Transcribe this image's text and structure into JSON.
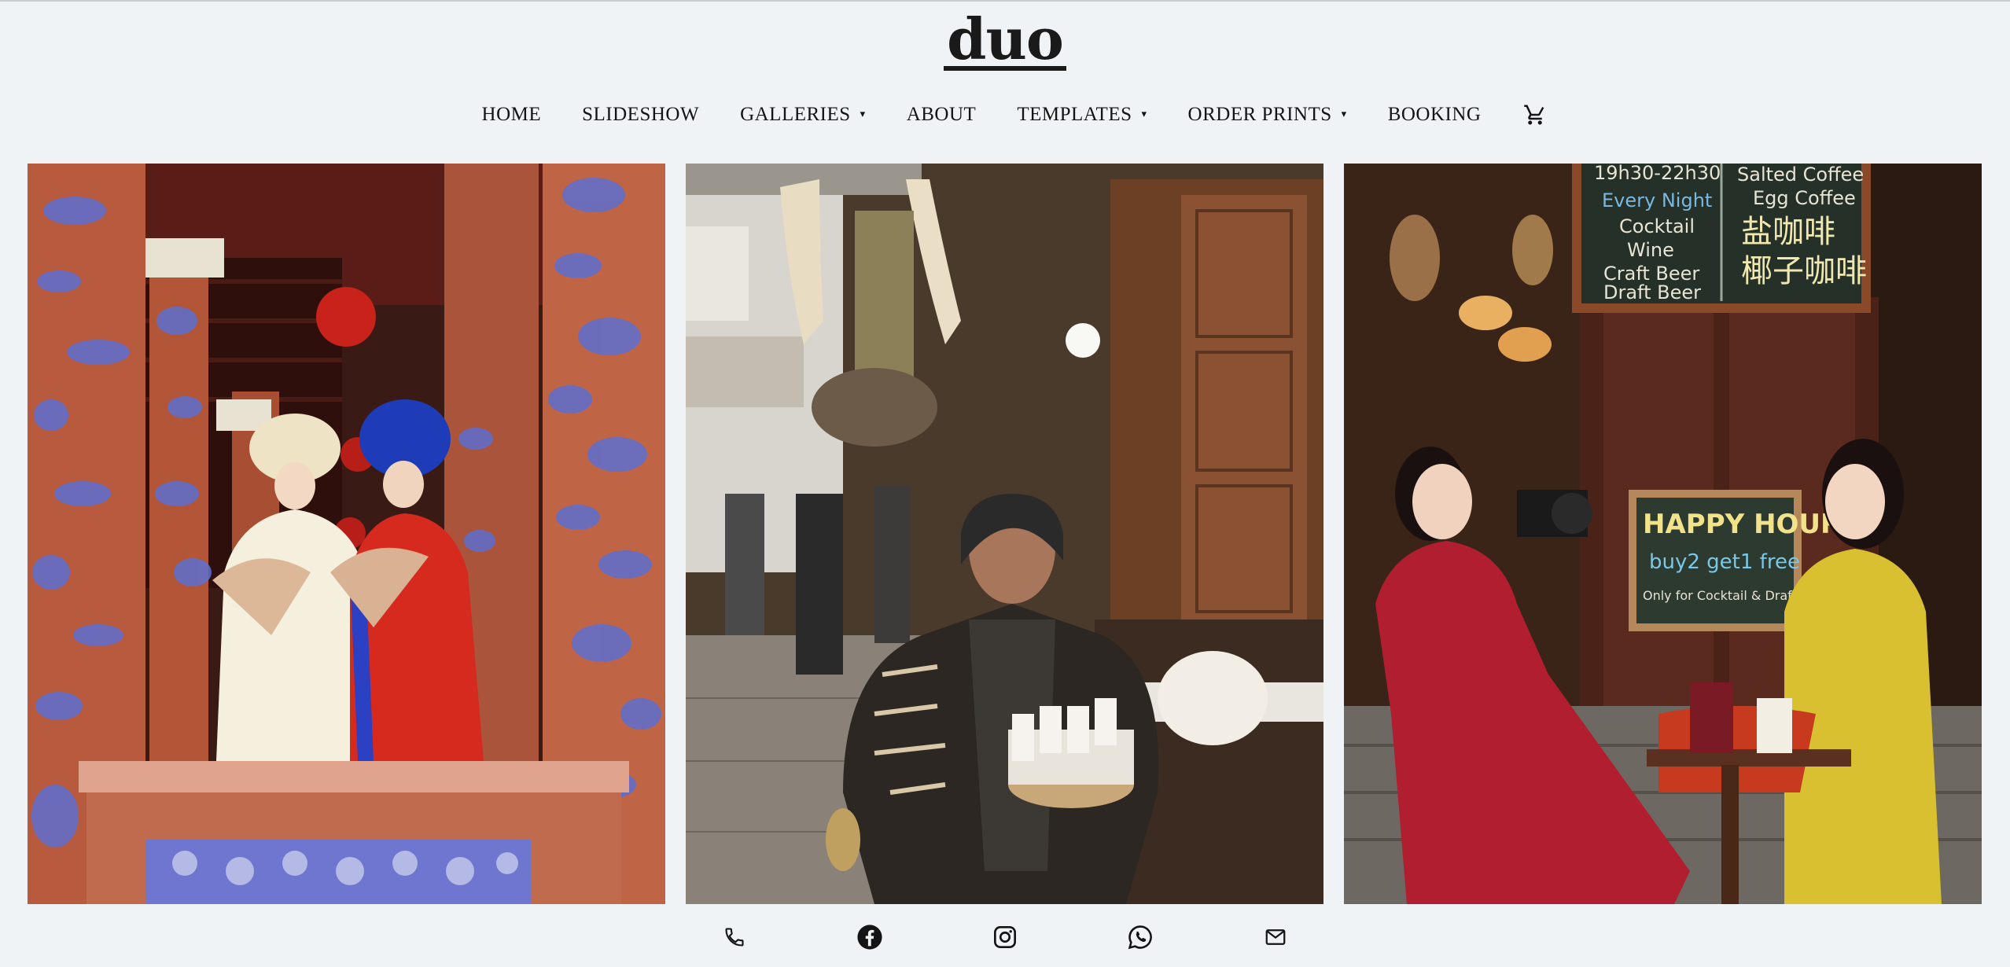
{
  "site": {
    "logo": "duo"
  },
  "nav": {
    "items": [
      {
        "label": "HOME",
        "has_dropdown": false
      },
      {
        "label": "SLIDESHOW",
        "has_dropdown": false
      },
      {
        "label": "GALLERIES",
        "has_dropdown": true
      },
      {
        "label": "ABOUT",
        "has_dropdown": false
      },
      {
        "label": "TEMPLATES",
        "has_dropdown": true
      },
      {
        "label": "ORDER PRINTS",
        "has_dropdown": true
      },
      {
        "label": "BOOKING",
        "has_dropdown": false
      }
    ],
    "caret": "▾",
    "cart_icon": "cart-icon"
  },
  "gallery": {
    "photos": [
      {
        "name": "two women in ao dai with fans on temple balcony"
      },
      {
        "name": "street vendor with cups in market alley"
      },
      {
        "name": "two women at cafe with camera",
        "chalkboard_top": [
          "19h30-22h30",
          "Every Night",
          "Cocktail",
          "Wine",
          "Craft Beer",
          "Draft Beer"
        ],
        "chalkboard_right": [
          "Salted Coffee",
          "Egg Coffee",
          "盐咖啡",
          "椰子咖啡"
        ],
        "sign_lines": [
          "HAPPY HOUR",
          "buy2 get1 free",
          "Only for Cocktail & Draft Beer"
        ]
      }
    ]
  },
  "social": {
    "icons": [
      "phone-icon",
      "facebook-icon",
      "instagram-icon",
      "whatsapp-icon",
      "mail-icon"
    ]
  },
  "colors": {
    "background": "#f0f3f6",
    "text": "#141414"
  }
}
